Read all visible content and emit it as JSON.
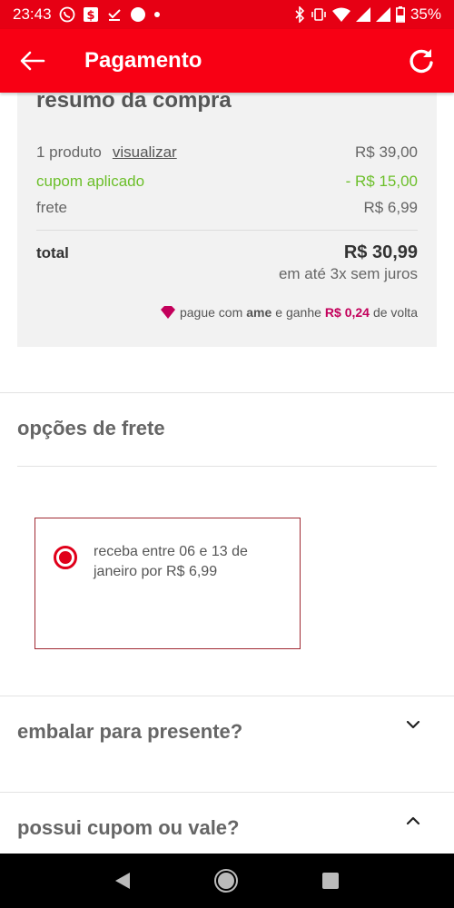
{
  "status_bar": {
    "time": "23:43",
    "battery": "35%",
    "icons_left": [
      "whatsapp-icon",
      "dollar-app-icon",
      "download-done-icon",
      "circle-icon",
      "dot-icon"
    ],
    "icons_right": [
      "bluetooth-icon",
      "vibrate-icon",
      "wifi-icon",
      "signal-icon",
      "signal-icon",
      "battery-icon"
    ]
  },
  "app_bar": {
    "title": "Pagamento",
    "back_icon": "arrow-left-icon",
    "refresh_icon": "refresh-icon"
  },
  "summary": {
    "title": "resumo da compra",
    "product_count": "1 produto",
    "view_link": "visualizar",
    "product_value": "R$ 39,00",
    "coupon_label": "cupom aplicado",
    "coupon_value": "- R$ 15,00",
    "shipping_label": "frete",
    "shipping_value": "R$ 6,99",
    "total_label": "total",
    "total_value": "R$ 30,99",
    "installments": "em até 3x sem juros",
    "ame_prefix": "pague com",
    "ame_brand": "ame",
    "ame_middle": "e ganhe",
    "ame_amount": "R$ 0,24",
    "ame_suffix": "de volta"
  },
  "shipping_options": {
    "title": "opções de frete",
    "option_text": "receba entre 06 e 13 de janeiro por R$ 6,99",
    "selected": true
  },
  "gift": {
    "title": "embalar para presente?",
    "expanded": false
  },
  "coupon": {
    "title": "possui cupom ou vale?",
    "expanded": true
  },
  "colors": {
    "brand_red": "#f80014",
    "coupon_green": "#6cbf2a",
    "ame_pink": "#c3005b"
  }
}
